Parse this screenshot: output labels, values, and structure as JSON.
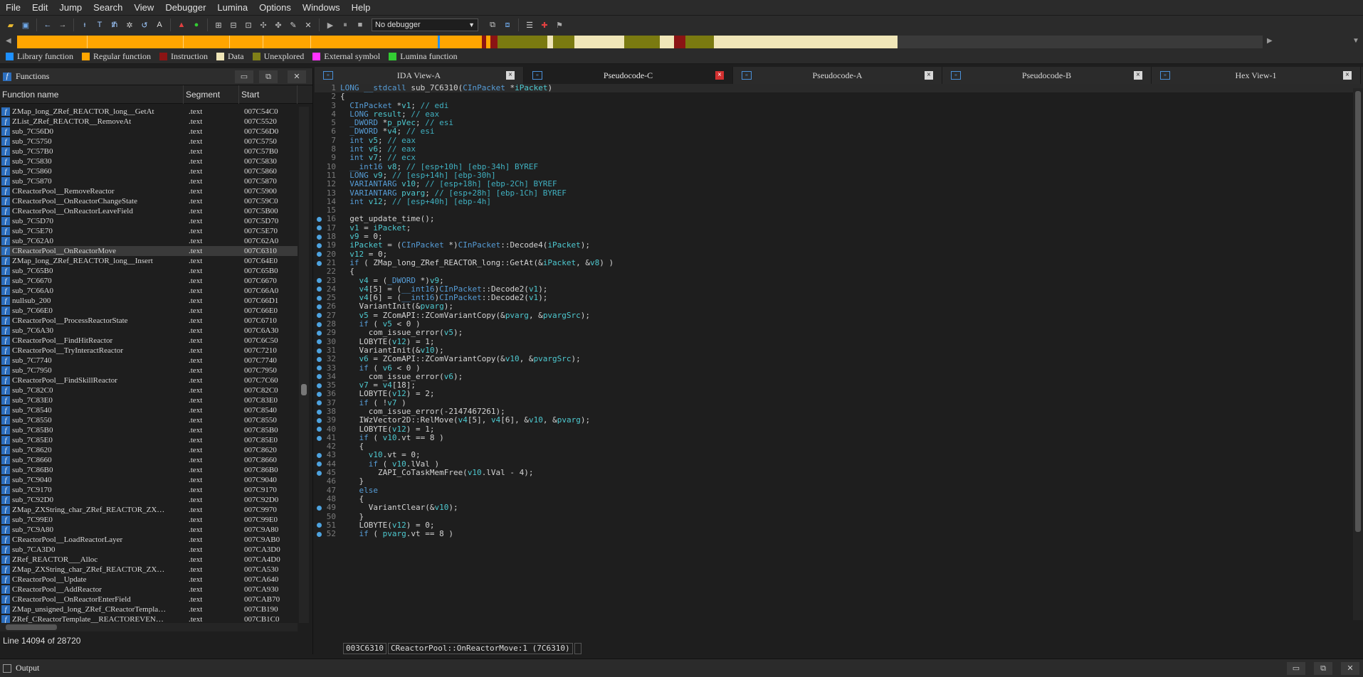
{
  "menu": [
    "File",
    "Edit",
    "Jump",
    "Search",
    "View",
    "Debugger",
    "Lumina",
    "Options",
    "Windows",
    "Help"
  ],
  "toolbar": {
    "debugger_value": "No debugger",
    "icons": [
      "open-icon",
      "save-icon",
      "back-icon",
      "forward-icon",
      "code-icon",
      "data-icon",
      "struct-icon",
      "enum-icon",
      "string-icon",
      "graph-icon",
      "run-icon",
      "pause-icon",
      "stop-icon"
    ]
  },
  "navbar": {
    "colors": {
      "library": "#1e90ff",
      "regular": "#ffa500",
      "instruction": "#8b1414",
      "data": "#f0e6b8",
      "unexplored": "#7a7a10",
      "external": "#ff00ff",
      "lumina": "#33cc33"
    }
  },
  "legend": [
    {
      "label": "Library function",
      "color": "#1e90ff"
    },
    {
      "label": "Regular function",
      "color": "#ffa500"
    },
    {
      "label": "Instruction",
      "color": "#8b1414"
    },
    {
      "label": "Data",
      "color": "#f0e6b8"
    },
    {
      "label": "Unexplored",
      "color": "#808018"
    },
    {
      "label": "External symbol",
      "color": "#ff33ff"
    },
    {
      "label": "Lumina function",
      "color": "#33cc33"
    }
  ],
  "functions_panel": {
    "title": "Functions",
    "columns": {
      "name": "Function name",
      "segment": "Segment",
      "start": "Start"
    },
    "rows": [
      {
        "name": "ZMap_long_ZRef_REACTOR_long__GetAt",
        "seg": ".text",
        "start": "007C54C0"
      },
      {
        "name": "ZList_ZRef_REACTOR__RemoveAt",
        "seg": ".text",
        "start": "007C5520"
      },
      {
        "name": "sub_7C56D0",
        "seg": ".text",
        "start": "007C56D0"
      },
      {
        "name": "sub_7C5750",
        "seg": ".text",
        "start": "007C5750"
      },
      {
        "name": "sub_7C57B0",
        "seg": ".text",
        "start": "007C57B0"
      },
      {
        "name": "sub_7C5830",
        "seg": ".text",
        "start": "007C5830"
      },
      {
        "name": "sub_7C5860",
        "seg": ".text",
        "start": "007C5860"
      },
      {
        "name": "sub_7C5870",
        "seg": ".text",
        "start": "007C5870"
      },
      {
        "name": "CReactorPool__RemoveReactor",
        "seg": ".text",
        "start": "007C5900"
      },
      {
        "name": "CReactorPool__OnReactorChangeState",
        "seg": ".text",
        "start": "007C59C0"
      },
      {
        "name": "CReactorPool__OnReactorLeaveField",
        "seg": ".text",
        "start": "007C5B00"
      },
      {
        "name": "sub_7C5D70",
        "seg": ".text",
        "start": "007C5D70"
      },
      {
        "name": "sub_7C5E70",
        "seg": ".text",
        "start": "007C5E70"
      },
      {
        "name": "sub_7C62A0",
        "seg": ".text",
        "start": "007C62A0"
      },
      {
        "name": "CReactorPool__OnReactorMove",
        "seg": ".text",
        "start": "007C6310"
      },
      {
        "name": "ZMap_long_ZRef_REACTOR_long__Insert",
        "seg": ".text",
        "start": "007C64E0"
      },
      {
        "name": "sub_7C65B0",
        "seg": ".text",
        "start": "007C65B0"
      },
      {
        "name": "sub_7C6670",
        "seg": ".text",
        "start": "007C6670"
      },
      {
        "name": "sub_7C66A0",
        "seg": ".text",
        "start": "007C66A0"
      },
      {
        "name": "nullsub_200",
        "seg": ".text",
        "start": "007C66D1"
      },
      {
        "name": "sub_7C66E0",
        "seg": ".text",
        "start": "007C66E0"
      },
      {
        "name": "CReactorPool__ProcessReactorState",
        "seg": ".text",
        "start": "007C6710"
      },
      {
        "name": "sub_7C6A30",
        "seg": ".text",
        "start": "007C6A30"
      },
      {
        "name": "CReactorPool__FindHitReactor",
        "seg": ".text",
        "start": "007C6C50"
      },
      {
        "name": "CReactorPool__TryInteractReactor",
        "seg": ".text",
        "start": "007C7210"
      },
      {
        "name": "sub_7C7740",
        "seg": ".text",
        "start": "007C7740"
      },
      {
        "name": "sub_7C7950",
        "seg": ".text",
        "start": "007C7950"
      },
      {
        "name": "CReactorPool__FindSkillReactor",
        "seg": ".text",
        "start": "007C7C60"
      },
      {
        "name": "sub_7C82C0",
        "seg": ".text",
        "start": "007C82C0"
      },
      {
        "name": "sub_7C83E0",
        "seg": ".text",
        "start": "007C83E0"
      },
      {
        "name": "sub_7C8540",
        "seg": ".text",
        "start": "007C8540"
      },
      {
        "name": "sub_7C8550",
        "seg": ".text",
        "start": "007C8550"
      },
      {
        "name": "sub_7C85B0",
        "seg": ".text",
        "start": "007C85B0"
      },
      {
        "name": "sub_7C85E0",
        "seg": ".text",
        "start": "007C85E0"
      },
      {
        "name": "sub_7C8620",
        "seg": ".text",
        "start": "007C8620"
      },
      {
        "name": "sub_7C8660",
        "seg": ".text",
        "start": "007C8660"
      },
      {
        "name": "sub_7C86B0",
        "seg": ".text",
        "start": "007C86B0"
      },
      {
        "name": "sub_7C9040",
        "seg": ".text",
        "start": "007C9040"
      },
      {
        "name": "sub_7C9170",
        "seg": ".text",
        "start": "007C9170"
      },
      {
        "name": "sub_7C92D0",
        "seg": ".text",
        "start": "007C92D0"
      },
      {
        "name": "ZMap_ZXString_char_ZRef_REACTOR_ZX…",
        "seg": ".text",
        "start": "007C9970"
      },
      {
        "name": "sub_7C99E0",
        "seg": ".text",
        "start": "007C99E0"
      },
      {
        "name": "sub_7C9A80",
        "seg": ".text",
        "start": "007C9A80"
      },
      {
        "name": "CReactorPool__LoadReactorLayer",
        "seg": ".text",
        "start": "007C9AB0"
      },
      {
        "name": "sub_7CA3D0",
        "seg": ".text",
        "start": "007CA3D0"
      },
      {
        "name": "ZRef_REACTOR___Alloc",
        "seg": ".text",
        "start": "007CA4D0"
      },
      {
        "name": "ZMap_ZXString_char_ZRef_REACTOR_ZX…",
        "seg": ".text",
        "start": "007CA530"
      },
      {
        "name": "CReactorPool__Update",
        "seg": ".text",
        "start": "007CA640"
      },
      {
        "name": "CReactorPool__AddReactor",
        "seg": ".text",
        "start": "007CA930"
      },
      {
        "name": "CReactorPool__OnReactorEnterField",
        "seg": ".text",
        "start": "007CAB70"
      },
      {
        "name": "ZMap_unsigned_long_ZRef_CReactorTempla…",
        "seg": ".text",
        "start": "007CB190"
      },
      {
        "name": "ZRef_CReactorTemplate__REACTOREVEN…",
        "seg": ".text",
        "start": "007CB1C0"
      }
    ],
    "selected_index": 14,
    "status": "Line 14094 of 28720"
  },
  "tabs": [
    {
      "label": "IDA View-A",
      "active": false
    },
    {
      "label": "Pseudocode-C",
      "active": true
    },
    {
      "label": "Pseudocode-A",
      "active": false
    },
    {
      "label": "Pseudocode-B",
      "active": false
    },
    {
      "label": "Hex View-1",
      "active": false
    }
  ],
  "code": [
    {
      "n": 1,
      "bp": false,
      "text": "LONG __stdcall sub_7C6310(CInPacket *iPacket)"
    },
    {
      "n": 2,
      "bp": false,
      "text": "{"
    },
    {
      "n": 3,
      "bp": false,
      "text": "  CInPacket *v1; // edi"
    },
    {
      "n": 4,
      "bp": false,
      "text": "  LONG result; // eax"
    },
    {
      "n": 5,
      "bp": false,
      "text": "  _DWORD *p_pVec; // esi"
    },
    {
      "n": 6,
      "bp": false,
      "text": "  _DWORD *v4; // esi"
    },
    {
      "n": 7,
      "bp": false,
      "text": "  int v5; // eax"
    },
    {
      "n": 8,
      "bp": false,
      "text": "  int v6; // eax"
    },
    {
      "n": 9,
      "bp": false,
      "text": "  int v7; // ecx"
    },
    {
      "n": 10,
      "bp": false,
      "text": "  __int16 v8; // [esp+10h] [ebp-34h] BYREF"
    },
    {
      "n": 11,
      "bp": false,
      "text": "  LONG v9; // [esp+14h] [ebp-30h]"
    },
    {
      "n": 12,
      "bp": false,
      "text": "  VARIANTARG v10; // [esp+18h] [ebp-2Ch] BYREF"
    },
    {
      "n": 13,
      "bp": false,
      "text": "  VARIANTARG pvarg; // [esp+28h] [ebp-1Ch] BYREF"
    },
    {
      "n": 14,
      "bp": false,
      "text": "  int v12; // [esp+40h] [ebp-4h]"
    },
    {
      "n": 15,
      "bp": false,
      "text": ""
    },
    {
      "n": 16,
      "bp": true,
      "text": "  get_update_time();"
    },
    {
      "n": 17,
      "bp": true,
      "text": "  v1 = iPacket;"
    },
    {
      "n": 18,
      "bp": true,
      "text": "  v9 = 0;"
    },
    {
      "n": 19,
      "bp": true,
      "text": "  iPacket = (CInPacket *)CInPacket::Decode4(iPacket);"
    },
    {
      "n": 20,
      "bp": true,
      "text": "  v12 = 0;"
    },
    {
      "n": 21,
      "bp": true,
      "text": "  if ( ZMap_long_ZRef_REACTOR_long::GetAt(&iPacket, &v8) )"
    },
    {
      "n": 22,
      "bp": false,
      "text": "  {"
    },
    {
      "n": 23,
      "bp": true,
      "text": "    v4 = (_DWORD *)v9;"
    },
    {
      "n": 24,
      "bp": true,
      "text": "    v4[5] = (__int16)CInPacket::Decode2(v1);"
    },
    {
      "n": 25,
      "bp": true,
      "text": "    v4[6] = (__int16)CInPacket::Decode2(v1);"
    },
    {
      "n": 26,
      "bp": true,
      "text": "    VariantInit(&pvarg);"
    },
    {
      "n": 27,
      "bp": true,
      "text": "    v5 = ZComAPI::ZComVariantCopy(&pvarg, &pvargSrc);"
    },
    {
      "n": 28,
      "bp": true,
      "text": "    if ( v5 < 0 )"
    },
    {
      "n": 29,
      "bp": true,
      "text": "      com_issue_error(v5);"
    },
    {
      "n": 30,
      "bp": true,
      "text": "    LOBYTE(v12) = 1;"
    },
    {
      "n": 31,
      "bp": true,
      "text": "    VariantInit(&v10);"
    },
    {
      "n": 32,
      "bp": true,
      "text": "    v6 = ZComAPI::ZComVariantCopy(&v10, &pvargSrc);"
    },
    {
      "n": 33,
      "bp": true,
      "text": "    if ( v6 < 0 )"
    },
    {
      "n": 34,
      "bp": true,
      "text": "      com_issue_error(v6);"
    },
    {
      "n": 35,
      "bp": true,
      "text": "    v7 = v4[18];"
    },
    {
      "n": 36,
      "bp": true,
      "text": "    LOBYTE(v12) = 2;"
    },
    {
      "n": 37,
      "bp": true,
      "text": "    if ( !v7 )"
    },
    {
      "n": 38,
      "bp": true,
      "text": "      com_issue_error(-2147467261);"
    },
    {
      "n": 39,
      "bp": true,
      "text": "    IWzVector2D::RelMove(v4[5], v4[6], &v10, &pvarg);"
    },
    {
      "n": 40,
      "bp": true,
      "text": "    LOBYTE(v12) = 1;"
    },
    {
      "n": 41,
      "bp": true,
      "text": "    if ( v10.vt == 8 )"
    },
    {
      "n": 42,
      "bp": false,
      "text": "    {"
    },
    {
      "n": 43,
      "bp": true,
      "text": "      v10.vt = 0;"
    },
    {
      "n": 44,
      "bp": true,
      "text": "      if ( v10.lVal )"
    },
    {
      "n": 45,
      "bp": true,
      "text": "        ZAPI_CoTaskMemFree(v10.lVal - 4);"
    },
    {
      "n": 46,
      "bp": false,
      "text": "    }"
    },
    {
      "n": 47,
      "bp": false,
      "text": "    else"
    },
    {
      "n": 48,
      "bp": false,
      "text": "    {"
    },
    {
      "n": 49,
      "bp": true,
      "text": "      VariantClear(&v10);"
    },
    {
      "n": 50,
      "bp": false,
      "text": "    }"
    },
    {
      "n": 51,
      "bp": true,
      "text": "    LOBYTE(v12) = 0;"
    },
    {
      "n": 52,
      "bp": true,
      "text": "    if ( pvarg.vt == 8 )"
    }
  ],
  "status_bar": {
    "address": "003C6310",
    "location": "CReactorPool::OnReactorMove:1 (7C6310)"
  },
  "output": {
    "label": "Output"
  }
}
